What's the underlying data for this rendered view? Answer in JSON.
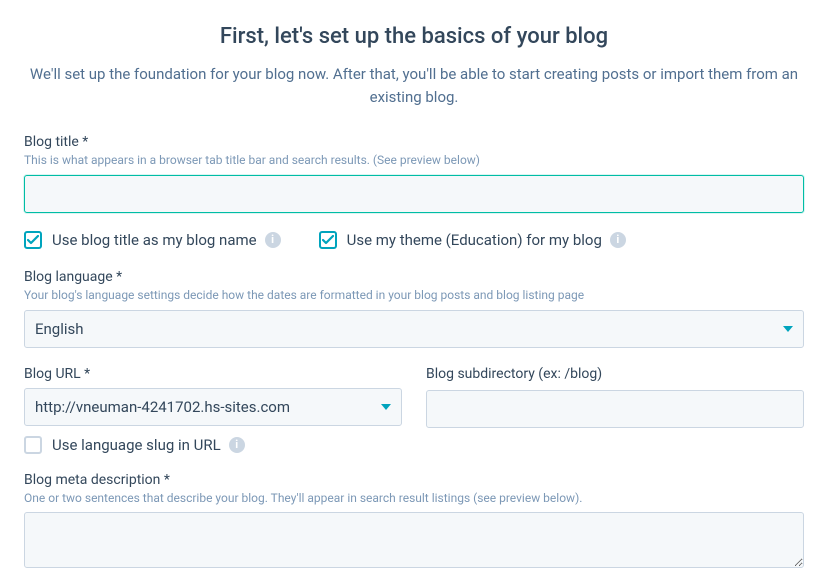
{
  "header": {
    "title": "First, let's set up the basics of your blog",
    "subtitle": "We'll set up the foundation for your blog now. After that, you'll be able to start creating posts or import them from an existing blog."
  },
  "blogTitle": {
    "label": "Blog title *",
    "help": "This is what appears in a browser tab title bar and search results. (See preview below)",
    "value": ""
  },
  "checkboxes": {
    "useTitleAsName": {
      "label": "Use blog title as my blog name",
      "checked": true
    },
    "useTheme": {
      "label": "Use my theme (Education) for my blog",
      "checked": true
    }
  },
  "blogLanguage": {
    "label": "Blog language *",
    "help": "Your blog's language settings decide how the dates are formatted in your blog posts and blog listing page",
    "value": "English"
  },
  "blogUrl": {
    "label": "Blog URL *",
    "value": "http://vneuman-4241702.hs-sites.com"
  },
  "blogSubdirectory": {
    "label": "Blog subdirectory (ex: /blog)",
    "value": ""
  },
  "useLanguageSlug": {
    "label": "Use language slug in URL",
    "checked": false
  },
  "metaDescription": {
    "label": "Blog meta description *",
    "help": "One or two sentences that describe your blog. They'll appear in search result listings (see preview below).",
    "value": ""
  }
}
